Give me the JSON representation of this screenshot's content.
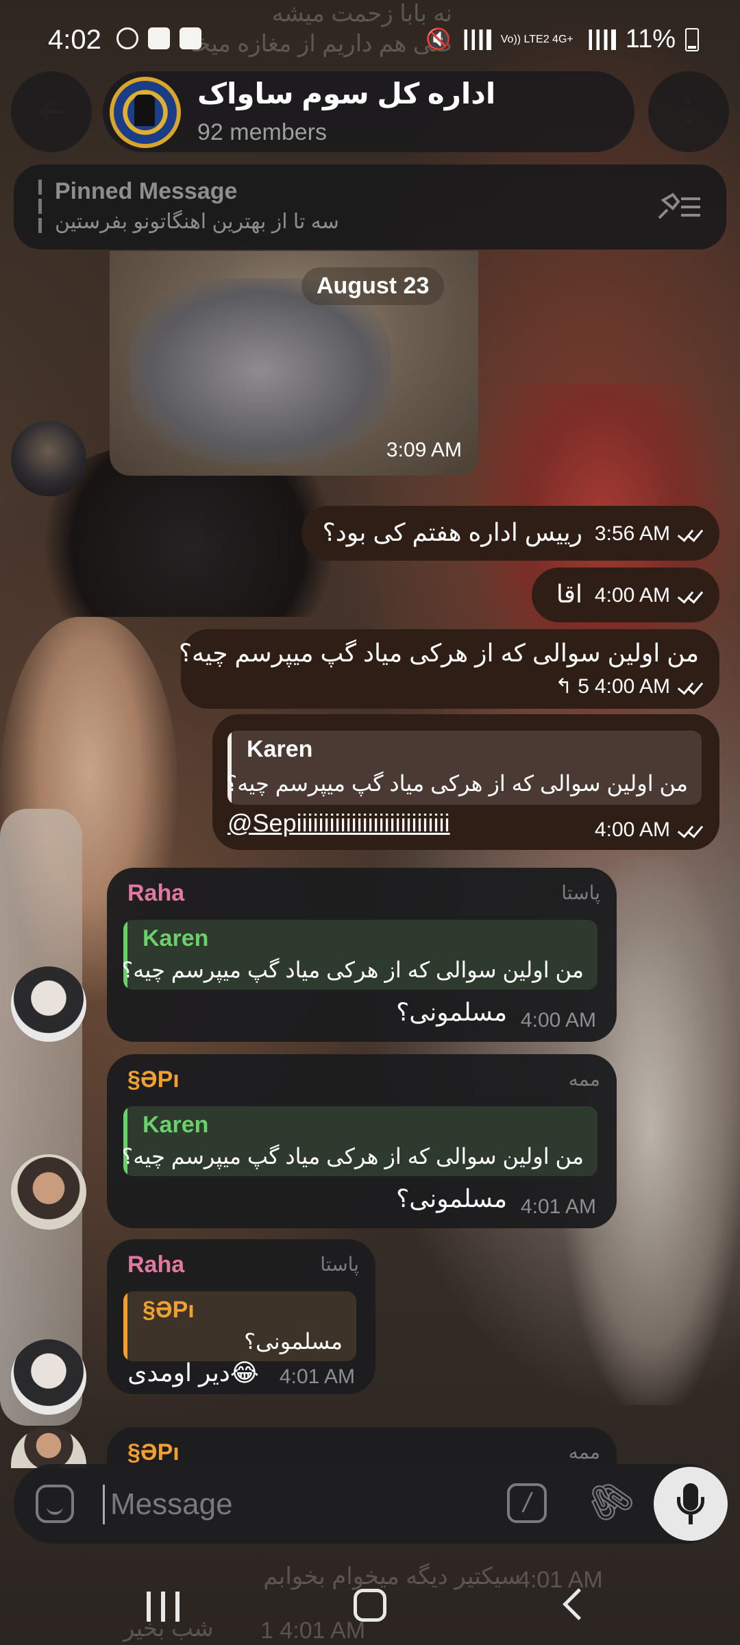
{
  "status_bar": {
    "time": "4:02",
    "network": "Vo)) LTE2 4G+",
    "battery": "11%"
  },
  "header": {
    "group_name": "اداره کل سوم ساواک",
    "members": "92 members"
  },
  "pinned": {
    "title": "Pinned Message",
    "text": "سه تا از بهترین اهنگاتونو بفرستین"
  },
  "date_chip": "August 23",
  "media_time": "3:09 AM",
  "outgoing": [
    {
      "text": "رییس اداره هفتم کی بود؟",
      "time": "3:56 AM"
    },
    {
      "text": "اقا",
      "time": "4:00 AM"
    },
    {
      "text": "من اولین سوالی که از هرکی میاد گپ میپرسم چیه؟",
      "time": "4:00 AM",
      "replies": "5"
    },
    {
      "quote_author": "Karen",
      "quote_text": "من اولین سوالی که از هرکی میاد گپ میپرسم چیه؟",
      "mention": "@Sepiiiiiiiiiiiiiiiiiiiiiiiiiiii",
      "time": "4:00 AM"
    }
  ],
  "incoming": [
    {
      "author": "Raha",
      "rank": "پاستا",
      "quote_author": "Karen",
      "quote_text": "من اولین سوالی که از هرکی میاد گپ میپرسم چیه؟",
      "text": "مسلمونی؟",
      "time": "4:00 AM"
    },
    {
      "author": "§ƏPı",
      "rank": "ممه",
      "quote_author": "Karen",
      "quote_text": "من اولین سوالی که از هرکی میاد گپ میپرسم چیه؟",
      "text": "مسلمونی؟",
      "time": "4:01 AM"
    },
    {
      "author": "Raha",
      "rank": "پاستا",
      "quote_author": "§ƏPı",
      "quote_text": "مسلمونی؟",
      "text": "😂دیر اومدی",
      "time": "4:01 AM"
    },
    {
      "author": "§ƏPı",
      "rank": "ممه"
    }
  ],
  "ghost_lines": {
    "top1": "نه بابا زحمت میشه",
    "top2": "صی هم داریم از مغازه میخا",
    "bottom1": "سیکتیر دیگه میخوام بخوابم",
    "bottom1_time": "4:01 AM",
    "bottom2": "شب بخیر",
    "bottom2_time": "1 4:01 AM"
  },
  "composer": {
    "placeholder": "Message",
    "command_glyph": "/"
  },
  "colors": {
    "outgoing_bubble": "#2e1e16",
    "incoming_bubble": "#1c1c1e",
    "raha_name": "#e178a0",
    "sepi_name": "#f0a030",
    "karen_quote": "#6ad069"
  }
}
